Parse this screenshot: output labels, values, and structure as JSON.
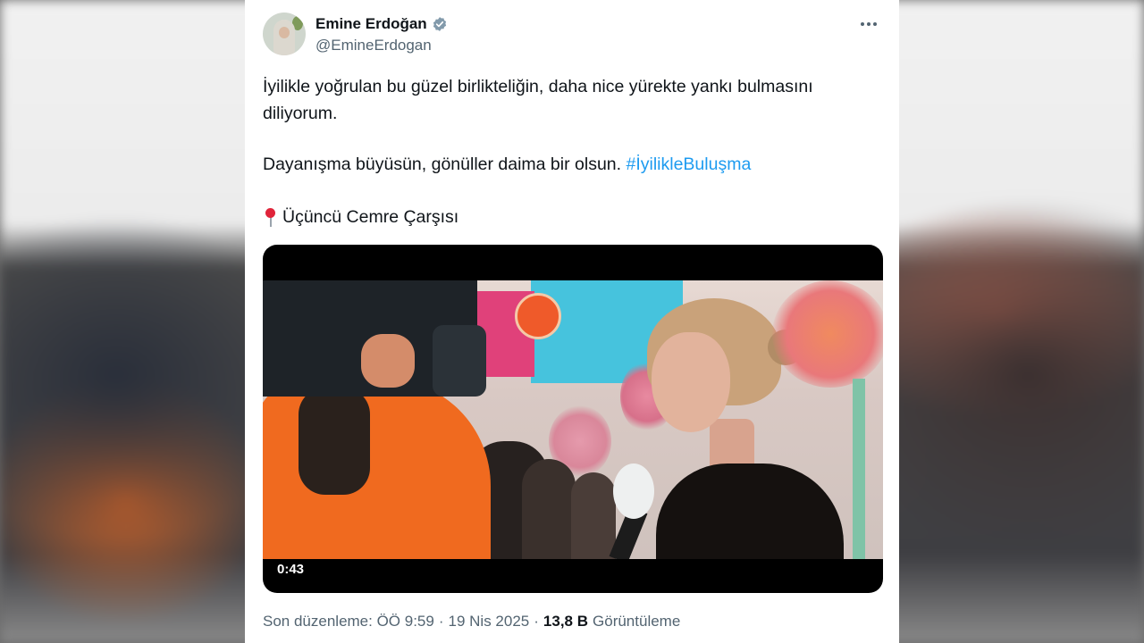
{
  "tweet": {
    "author": {
      "display_name": "Emine Erdoğan",
      "handle": "@EmineErdogan",
      "verified": true,
      "avatar_icon": "profile-photo"
    },
    "more_icon": "more-dots-icon",
    "paragraph_1": "İyilikle yoğrulan bu güzel birlikteliğin, daha nice yürekte yankı bulmasını diliyorum.",
    "paragraph_2_text": "Dayanışma büyüsün, gönüller daima bir olsun. ",
    "hashtag": "#İyilikleBuluşma",
    "location_icon": "round-pushpin-emoji",
    "location": "Üçüncü Cemre Çarşısı",
    "video": {
      "duration": "0:43"
    },
    "meta": {
      "edited_label": "Son düzenleme: ÖÖ 9:59",
      "separator": "·",
      "date": "19 Nis 2025",
      "views_count": "13,8 B",
      "views_label": "Görüntüleme"
    }
  },
  "colors": {
    "link": "#1d9bf0",
    "text_primary": "#0f1419",
    "text_secondary": "#536471",
    "verified_badge": "#829aab"
  }
}
